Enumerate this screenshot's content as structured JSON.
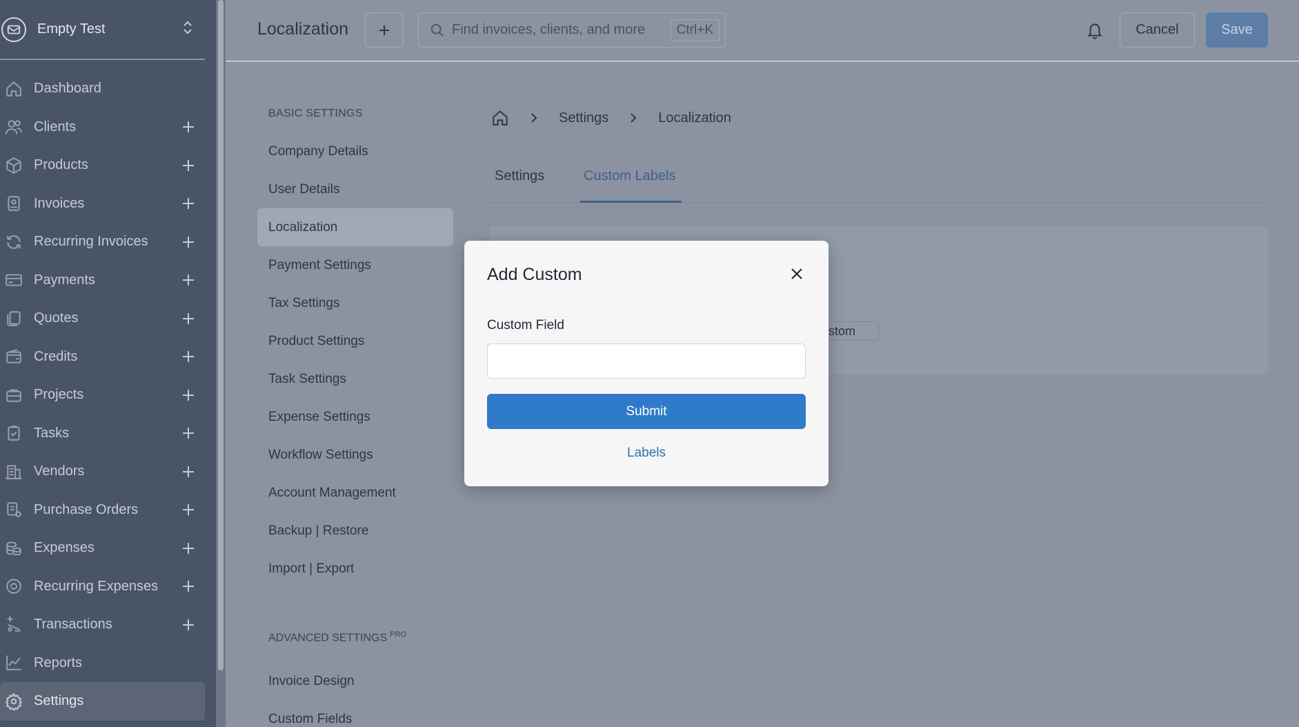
{
  "app": {
    "company_name": "Empty Test"
  },
  "sidebar": {
    "items": [
      {
        "label": "Dashboard",
        "icon": "home-icon",
        "has_add": false
      },
      {
        "label": "Clients",
        "icon": "users-icon",
        "has_add": true
      },
      {
        "label": "Products",
        "icon": "cube-icon",
        "has_add": true
      },
      {
        "label": "Invoices",
        "icon": "invoice-icon",
        "has_add": true
      },
      {
        "label": "Recurring Invoices",
        "icon": "refresh-icon",
        "has_add": true
      },
      {
        "label": "Payments",
        "icon": "credit-card-icon",
        "has_add": true
      },
      {
        "label": "Quotes",
        "icon": "files-icon",
        "has_add": true
      },
      {
        "label": "Credits",
        "icon": "wallet-icon",
        "has_add": true
      },
      {
        "label": "Projects",
        "icon": "briefcase-icon",
        "has_add": true
      },
      {
        "label": "Tasks",
        "icon": "clipboard-check-icon",
        "has_add": true
      },
      {
        "label": "Vendors",
        "icon": "building-icon",
        "has_add": true
      },
      {
        "label": "Purchase Orders",
        "icon": "purchase-order-icon",
        "has_add": true
      },
      {
        "label": "Expenses",
        "icon": "coins-icon",
        "has_add": true
      },
      {
        "label": "Recurring Expenses",
        "icon": "recurring-icon",
        "has_add": true
      },
      {
        "label": "Transactions",
        "icon": "transactions-icon",
        "has_add": true
      },
      {
        "label": "Reports",
        "icon": "chart-line-icon",
        "has_add": false
      },
      {
        "label": "Settings",
        "icon": "gear-icon",
        "has_add": false,
        "active": true
      }
    ]
  },
  "topbar": {
    "title": "Localization",
    "search_placeholder": "Find invoices, clients, and more",
    "search_shortcut": "Ctrl+K",
    "cancel_label": "Cancel",
    "save_label": "Save"
  },
  "settings_nav": {
    "basic_heading": "BASIC SETTINGS",
    "basic_items": [
      "Company Details",
      "User Details",
      "Localization",
      "Payment Settings",
      "Tax Settings",
      "Product Settings",
      "Task Settings",
      "Expense Settings",
      "Workflow Settings",
      "Account Management",
      "Backup | Restore",
      "Import | Export"
    ],
    "active_item": "Localization",
    "advanced_heading": "ADVANCED SETTINGS",
    "advanced_badge": "PRO",
    "advanced_items": [
      "Invoice Design",
      "Custom Fields"
    ]
  },
  "breadcrumb": {
    "items": [
      "Settings",
      "Localization"
    ]
  },
  "tabs": {
    "items": [
      "Settings",
      "Custom Labels"
    ],
    "active": "Custom Labels"
  },
  "panel": {
    "chip_text": "ustom"
  },
  "modal": {
    "title": "Add Custom",
    "field_label": "Custom Field",
    "field_value": "",
    "submit_label": "Submit",
    "link_label": "Labels"
  },
  "colors": {
    "primary": "#2f7bc9",
    "link": "#2f6fae",
    "sidebar_bg": "#495566",
    "overlay": "#8c93a0"
  }
}
